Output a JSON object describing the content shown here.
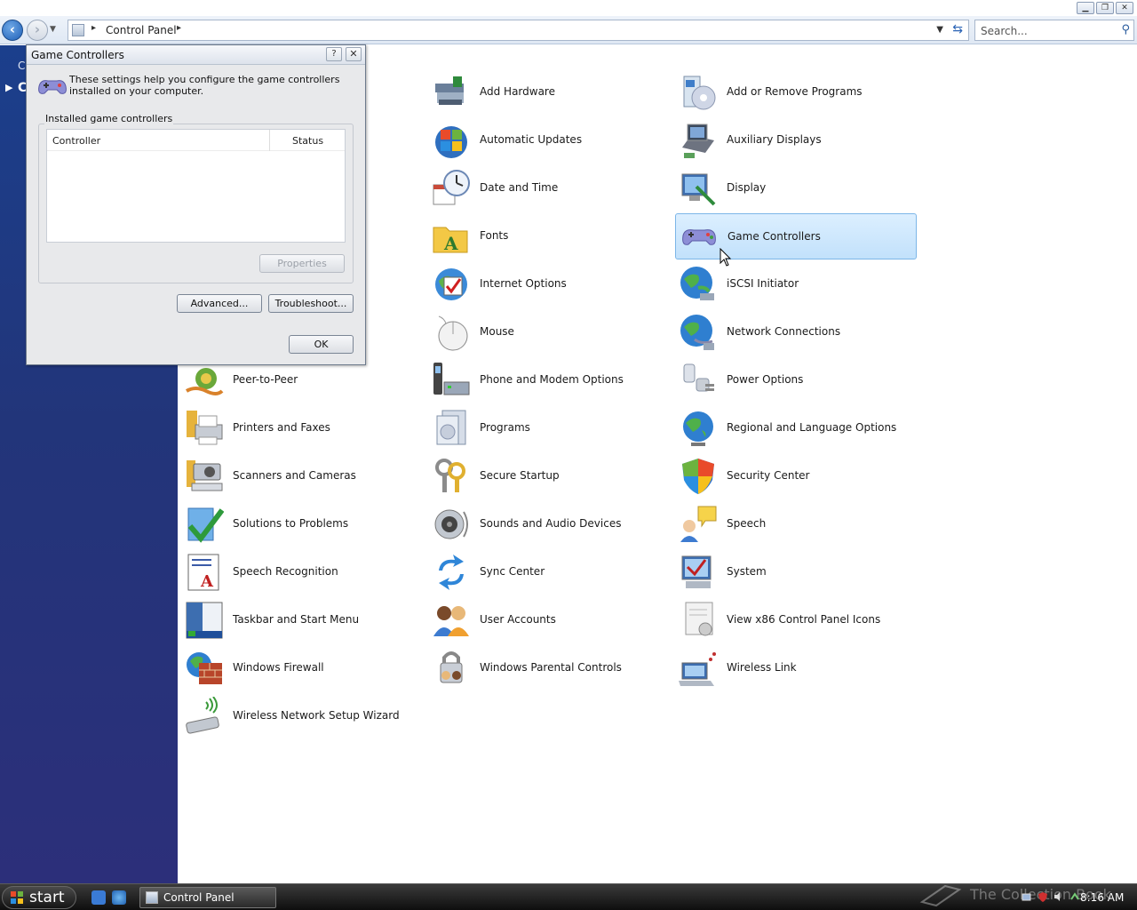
{
  "address_bar": {
    "path": "Control Panel",
    "search_placeholder": "Search..."
  },
  "left_pane": {
    "text1": "C",
    "text2": "C"
  },
  "items": [
    {
      "label": "Add Hardware",
      "icon": "add-hardware-icon"
    },
    {
      "label": "Add or Remove Programs",
      "icon": "add-remove-programs-icon"
    },
    {
      "label": "Automatic Updates",
      "icon": "automatic-updates-icon"
    },
    {
      "label": "Auxiliary Displays",
      "icon": "auxiliary-displays-icon"
    },
    {
      "label": "Date and Time",
      "icon": "date-time-icon"
    },
    {
      "label": "Display",
      "icon": "display-icon"
    },
    {
      "label": "Fonts",
      "icon": "fonts-icon"
    },
    {
      "label": "Game Controllers",
      "icon": "game-controllers-icon"
    },
    {
      "label": "Internet Options",
      "icon": "internet-options-icon"
    },
    {
      "label": "iSCSI Initiator",
      "icon": "iscsi-initiator-icon"
    },
    {
      "label": "Mouse",
      "icon": "mouse-icon"
    },
    {
      "label": "Network Connections",
      "icon": "network-connections-icon"
    },
    {
      "label": "Peer-to-Peer",
      "icon": "peer-to-peer-icon"
    },
    {
      "label": "Phone and Modem Options",
      "icon": "phone-modem-icon"
    },
    {
      "label": "Power Options",
      "icon": "power-options-icon"
    },
    {
      "label": "Printers and Faxes",
      "icon": "printers-faxes-icon"
    },
    {
      "label": "Programs",
      "icon": "programs-icon"
    },
    {
      "label": "Regional and Language Options",
      "icon": "regional-language-icon"
    },
    {
      "label": "Scanners and Cameras",
      "icon": "scanners-cameras-icon"
    },
    {
      "label": "Secure Startup",
      "icon": "secure-startup-icon"
    },
    {
      "label": "Security Center",
      "icon": "security-center-icon"
    },
    {
      "label": "Solutions to Problems",
      "icon": "solutions-problems-icon"
    },
    {
      "label": "Sounds and Audio Devices",
      "icon": "sounds-audio-icon"
    },
    {
      "label": "Speech",
      "icon": "speech-icon"
    },
    {
      "label": "Speech Recognition",
      "icon": "speech-recognition-icon"
    },
    {
      "label": "Sync Center",
      "icon": "sync-center-icon"
    },
    {
      "label": "System",
      "icon": "system-icon"
    },
    {
      "label": "Taskbar and Start Menu",
      "icon": "taskbar-start-menu-icon"
    },
    {
      "label": "User Accounts",
      "icon": "user-accounts-icon"
    },
    {
      "label": "View x86 Control Panel Icons",
      "icon": "view-x86-icons-icon"
    },
    {
      "label": "Windows Firewall",
      "icon": "windows-firewall-icon"
    },
    {
      "label": "Windows Parental Controls",
      "icon": "parental-controls-icon"
    },
    {
      "label": "Wireless Link",
      "icon": "wireless-link-icon"
    },
    {
      "label": "Wireless Network Setup Wizard",
      "icon": "wireless-network-wizard-icon"
    }
  ],
  "selected_item": "Game Controllers",
  "dialog": {
    "title": "Game Controllers",
    "help_label": "?",
    "close_label": "✕",
    "description": "These settings help you configure the game controllers installed on your computer.",
    "group_label": "Installed game controllers",
    "columns": [
      "Controller",
      "Status"
    ],
    "properties_label": "Properties",
    "advanced_label": "Advanced...",
    "troubleshoot_label": "Troubleshoot...",
    "ok_label": "OK"
  },
  "taskbar": {
    "start_label": "start",
    "task_label": "Control Panel",
    "watermark": "The Collection Book",
    "clock": "8:16 AM"
  },
  "colors": {
    "selection_bg": "#c2e1fb",
    "left_pane": "#22357a",
    "accent": "#1d5fb7"
  }
}
